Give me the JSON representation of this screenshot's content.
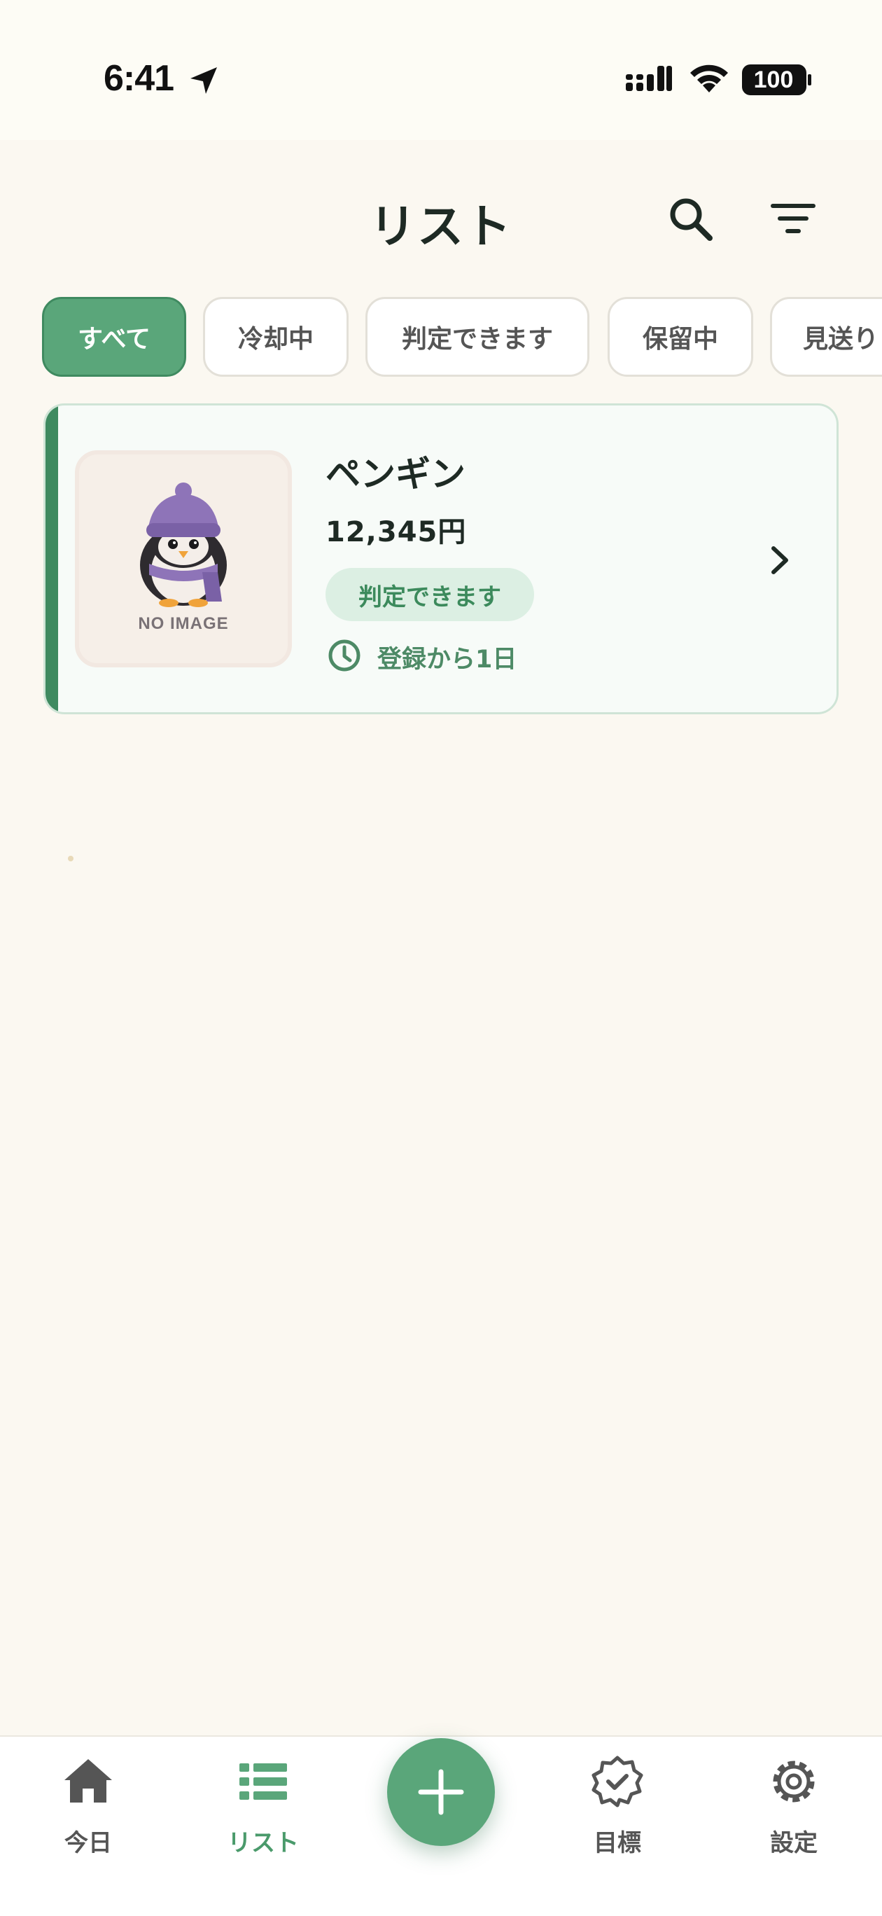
{
  "status_bar": {
    "time": "6:41",
    "battery": "100"
  },
  "header": {
    "title": "リスト"
  },
  "filter_chips": [
    {
      "label": "すべて",
      "active": true
    },
    {
      "label": "冷却中",
      "active": false
    },
    {
      "label": "判定できます",
      "active": false
    },
    {
      "label": "保留中",
      "active": false
    },
    {
      "label": "見送り",
      "active": false
    }
  ],
  "items": [
    {
      "name": "ペンギン",
      "price": "12,345円",
      "status": "判定できます",
      "elapsed": "登録から1日",
      "thumb_caption": "NO IMAGE"
    }
  ],
  "bottom_nav": {
    "today": "今日",
    "list": "リスト",
    "goals": "目標",
    "settings": "設定",
    "active": "list"
  },
  "colors": {
    "accent": "#5aa67a",
    "accent_dark": "#3f8a60",
    "background": "#fbf8f1"
  }
}
